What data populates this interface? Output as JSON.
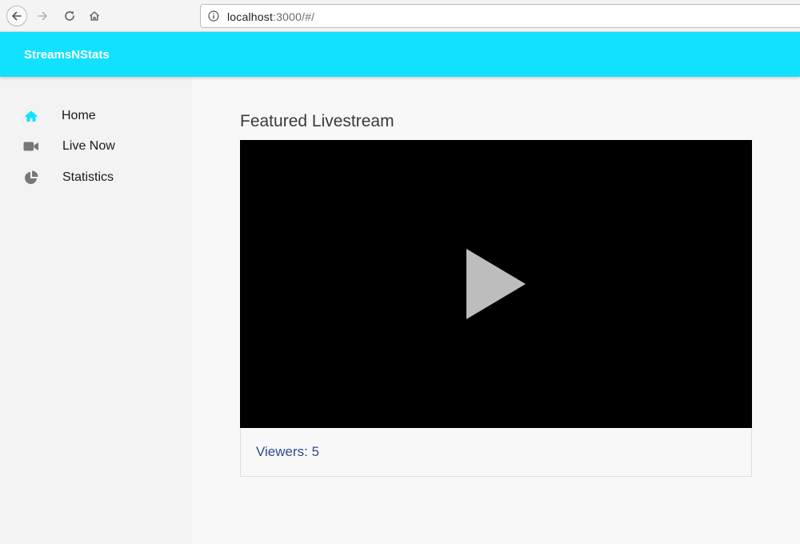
{
  "browser": {
    "url_host": "localhost",
    "url_rest": ":3000/#/",
    "icons": [
      "back-arrow-icon",
      "forward-arrow-icon",
      "reload-icon",
      "home-icon",
      "info-icon"
    ]
  },
  "header": {
    "brand": "StreamsNStats",
    "color": "#12e1ff"
  },
  "sidebar": {
    "items": [
      {
        "label": "Home",
        "icon": "home-icon",
        "active": true,
        "icon_color": "#12e1ff"
      },
      {
        "label": "Live Now",
        "icon": "video-camera-icon",
        "active": false,
        "icon_color": "#777777"
      },
      {
        "label": "Statistics",
        "icon": "pie-chart-icon",
        "active": false,
        "icon_color": "#777777"
      }
    ]
  },
  "main": {
    "title": "Featured Livestream",
    "player": {
      "icon": "play-icon"
    },
    "viewers_text": "Viewers: 5"
  }
}
